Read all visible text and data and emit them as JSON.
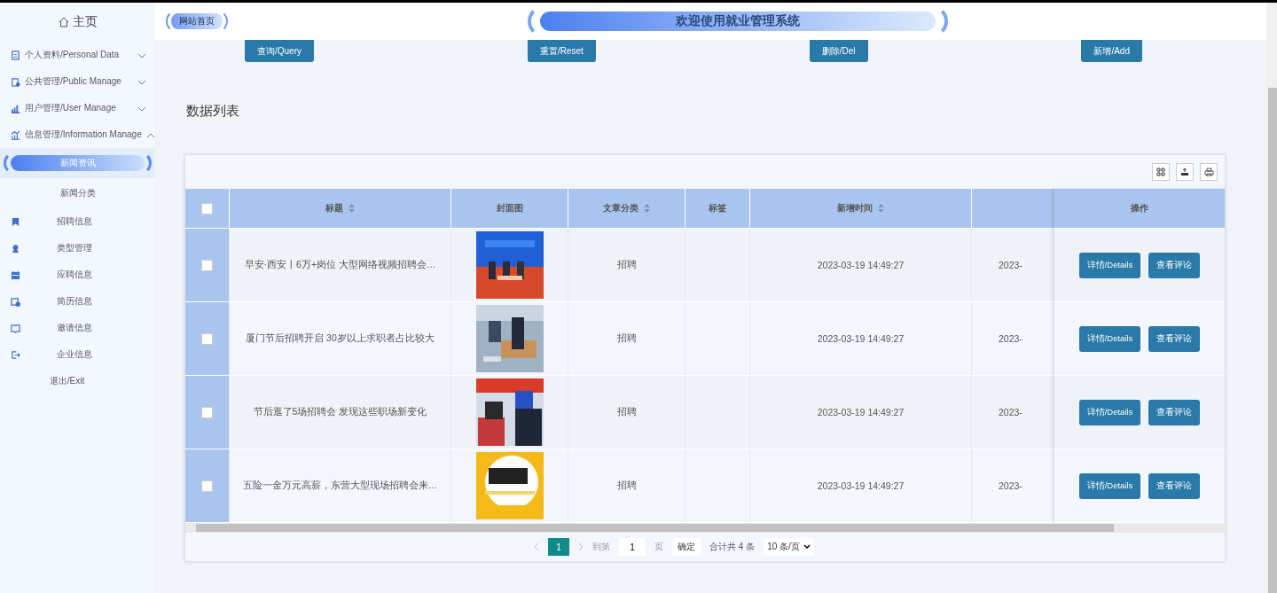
{
  "sidebar": {
    "home": "主页",
    "items": [
      {
        "label": "个人资料/Personal Data",
        "expanded": false
      },
      {
        "label": "公共管理/Public Manage",
        "expanded": false
      },
      {
        "label": "用户管理/User Manage",
        "expanded": false
      },
      {
        "label": "信息管理/Information Manage",
        "expanded": true,
        "children": [
          {
            "label": "新闻资讯",
            "selected": true
          },
          {
            "label": "新闻分类",
            "selected": false
          }
        ]
      },
      {
        "label": "招聘信息"
      },
      {
        "label": "类型管理"
      },
      {
        "label": "应聘信息"
      },
      {
        "label": "简历信息"
      },
      {
        "label": "邀请信息"
      },
      {
        "label": "企业信息"
      },
      {
        "label": "退出/Exit"
      }
    ]
  },
  "header": {
    "home_link": "网站首页",
    "title": "欢迎使用就业管理系统"
  },
  "actions": [
    "查询/Query",
    "重置/Reset",
    "删除/Del",
    "新增/Add"
  ],
  "section_title": "数据列表",
  "table": {
    "select_all": {
      "checked": false
    },
    "columns": [
      {
        "label": "标题",
        "sortable": true
      },
      {
        "label": "封面图",
        "sortable": false
      },
      {
        "label": "文章分类",
        "sortable": true
      },
      {
        "label": "标签",
        "sortable": false
      },
      {
        "label": "新增时间",
        "sortable": true
      }
    ],
    "action_column": "操作",
    "rows": [
      {
        "checked": false,
        "title": "早安·西安丨6万+岗位 大型网络视频招聘会…",
        "category": "招聘",
        "time": "2023-03-19 14:49:27",
        "column_7": "2023-",
        "buttons": [
          "详情/Details",
          "查看评论"
        ]
      },
      {
        "checked": false,
        "title": "厦门节后招聘开启 30岁以上求职者占比较大",
        "category": "招聘",
        "time": "2023-03-19 14:49:27",
        "column_7": "2023-",
        "buttons": [
          "详情/Details",
          "查看评论"
        ]
      },
      {
        "checked": false,
        "title": "节后逛了5场招聘会 发现这些职场新变化",
        "category": "招聘",
        "time": "2023-03-19 14:49:27",
        "column_7": "2023-",
        "buttons": [
          "详情/Details",
          "查看评论"
        ]
      },
      {
        "checked": false,
        "title": "五险一金万元高薪，东营大型现场招聘会来…",
        "category": "招聘",
        "time": "2023-03-19 14:49:27",
        "column_7": "2023-",
        "buttons": [
          "详情/Details",
          "查看评论"
        ]
      }
    ]
  },
  "pagination": {
    "pages": [
      {
        "label": "1",
        "selected": true
      }
    ],
    "goto_label": "到第",
    "goto_value": "1",
    "page_unit": "页",
    "confirm": "确定",
    "total": "合计共 4 条",
    "page_size": "10 条/页"
  }
}
